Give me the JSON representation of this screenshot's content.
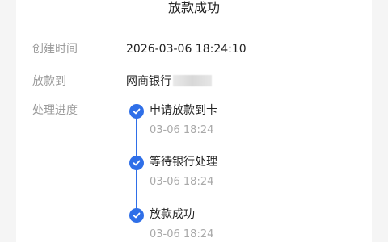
{
  "header": {
    "title": "放款成功"
  },
  "details": {
    "created_label": "创建时间",
    "created_value": "2026-03-06 18:24:10",
    "payee_label": "放款到",
    "payee_value": "网商银行",
    "progress_label": "处理进度"
  },
  "timeline": {
    "steps": [
      {
        "title": "申请放款到卡",
        "time": "03-06 18:24"
      },
      {
        "title": "等待银行处理",
        "time": "03-06 18:24"
      },
      {
        "title": "放款成功",
        "time": "03-06 18:24"
      }
    ]
  },
  "colors": {
    "accent": "#2f6fe8"
  }
}
